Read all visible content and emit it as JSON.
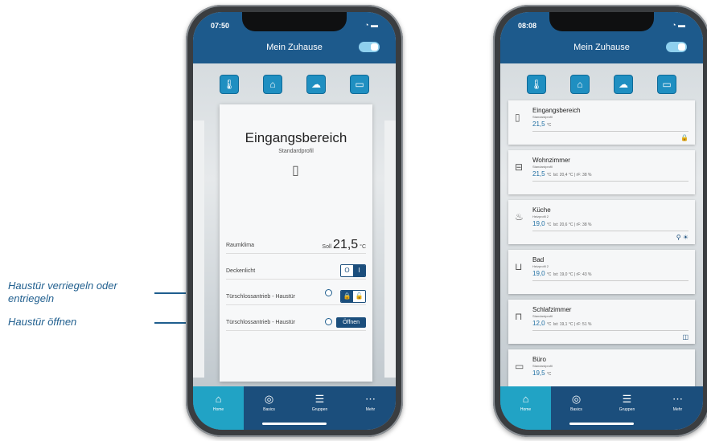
{
  "left_phone": {
    "time": "07:50",
    "title": "Mein Zuhause",
    "card": {
      "title": "Eingangsbereich",
      "subtitle": "Standardprofil",
      "rows": [
        {
          "label": "Raumklima",
          "soll_label": "Soll",
          "value": "21,5",
          "unit": "°C"
        },
        {
          "label": "Deckenlicht",
          "off": "O",
          "on": "I"
        },
        {
          "label": "Türschlossantrieb - Haustür"
        },
        {
          "label": "Türschlossantrieb - Haustür",
          "button": "Öffnen"
        }
      ]
    }
  },
  "right_phone": {
    "time": "08:08",
    "title": "Mein Zuhause",
    "rooms": [
      {
        "name": "Eingangsbereich",
        "profile": "Standardprofil",
        "temp": "21,5",
        "unit": "°C",
        "extra": ""
      },
      {
        "name": "Wohnzimmer",
        "profile": "Standardprofil",
        "temp": "21,5",
        "unit": "°C",
        "extra": "Ist: 20,4 °C | rF: 38 %"
      },
      {
        "name": "Küche",
        "profile": "Heizprofil 2",
        "temp": "19,0",
        "unit": "°C",
        "extra": "Ist: 20,6 °C | rF: 38 %"
      },
      {
        "name": "Bad",
        "profile": "Heizprofil 2",
        "temp": "19,0",
        "unit": "°C",
        "extra": "Ist: 19,0 °C | rF: 43 %"
      },
      {
        "name": "Schlafzimmer",
        "profile": "Standardprofil",
        "temp": "12,0",
        "unit": "°C",
        "extra": "Ist: 19,1 °C | rF: 51 %"
      },
      {
        "name": "Büro",
        "profile": "Standardprofil",
        "temp": "19,5",
        "unit": "°C",
        "extra": ""
      }
    ]
  },
  "nav": [
    "Home",
    "Basics",
    "Gruppen",
    "Mehr"
  ],
  "annotations": {
    "lock": "Haustür verriegeln oder entriegeln",
    "open": "Haustür öffnen"
  },
  "colors": {
    "primary": "#1d5a8c",
    "accent": "#21a3c5",
    "annotation": "#1f5e8e"
  }
}
